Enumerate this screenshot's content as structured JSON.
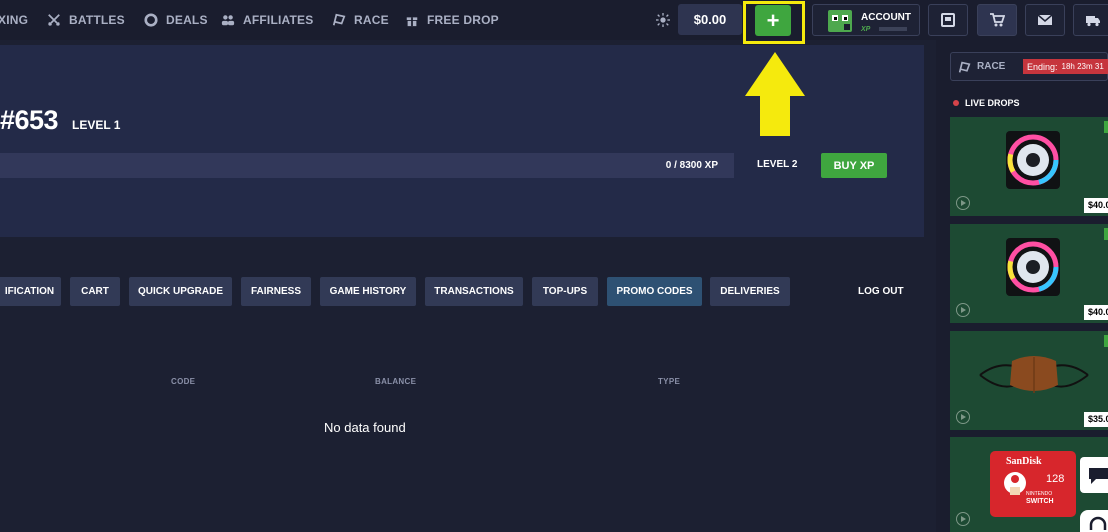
{
  "nav": {
    "items": [
      {
        "label": "XING",
        "icon": "unboxing-icon"
      },
      {
        "label": "BATTLES",
        "icon": "swords-icon"
      },
      {
        "label": "DEALS",
        "icon": "deals-icon"
      },
      {
        "label": "AFFILIATES",
        "icon": "users-icon"
      },
      {
        "label": "RACE",
        "icon": "race-flag-icon"
      },
      {
        "label": "FREE DROP",
        "icon": "gift-icon"
      }
    ],
    "balance": "$0.00",
    "deposit_label": "+",
    "account_label": "ACCOUNT",
    "account_xp_label": "XP"
  },
  "profile": {
    "username": "#653",
    "level_current": "LEVEL 1",
    "xp_progress": "0 / 8300 XP",
    "xp_fraction": 0,
    "level_next": "LEVEL 2",
    "buy_xp_label": "BUY XP"
  },
  "tabs": {
    "items": [
      {
        "label": "IFICATION",
        "active": false
      },
      {
        "label": "CART",
        "active": false
      },
      {
        "label": "QUICK UPGRADE",
        "active": false
      },
      {
        "label": "FAIRNESS",
        "active": false
      },
      {
        "label": "GAME HISTORY",
        "active": false
      },
      {
        "label": "TRANSACTIONS",
        "active": false
      },
      {
        "label": "TOP-UPS",
        "active": false
      },
      {
        "label": "PROMO CODES",
        "active": true
      },
      {
        "label": "DELIVERIES",
        "active": false
      }
    ],
    "logout_label": "LOG OUT"
  },
  "table": {
    "columns": [
      "CODE",
      "BALANCE",
      "TYPE"
    ],
    "empty_message": "No data found"
  },
  "sidebar": {
    "race_label": "RACE",
    "race_ending_label": "Ending:",
    "race_timer": "18h 23m 31",
    "live_drops_label": "LIVE DROPS",
    "drops": [
      {
        "item": "corsair-rgb-fan",
        "price": "$40.0"
      },
      {
        "item": "corsair-rgb-fan",
        "price": "$40.0"
      },
      {
        "item": "brown-face-mask",
        "price": "$35.0"
      },
      {
        "item": "sandisk-microsd-card",
        "price": "",
        "card_text": [
          "SanDisk",
          "128",
          "NINTENDO",
          "SWITCH"
        ]
      }
    ]
  },
  "colors": {
    "background": "#1c2032",
    "panel": "#232a48",
    "accent_green": "#3fa63f",
    "highlight_yellow": "#f5ea0d",
    "tab_active": "#2e5173",
    "drop_card": "#1d4a33"
  }
}
